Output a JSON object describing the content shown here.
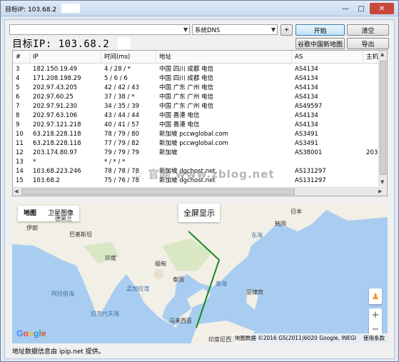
{
  "window": {
    "title": "目标IP: 103.68.2",
    "close_glyph": "✕",
    "min_glyph": "—",
    "max_glyph": "□"
  },
  "toolbar": {
    "target_input_value": "",
    "dns_select_value": "系统DNS",
    "add_label": "+",
    "start_label": "开始",
    "clear_label": "清空",
    "map_label": "谷歌中国新地图",
    "export_label": "导出",
    "target_ip_label": "目标IP: 103.68.2"
  },
  "table": {
    "columns": [
      "#",
      "IP",
      "时间(ms)",
      "地址",
      "AS",
      "主机"
    ],
    "rows": [
      [
        "3",
        "182.150.19.49",
        "4 / 28 / *",
        "中国 四川 成都 电信",
        "AS4134",
        ""
      ],
      [
        "4",
        "171.208.198.29",
        "5 / 6 / 6",
        "中国 四川 成都 电信",
        "AS4134",
        ""
      ],
      [
        "5",
        "202.97.43.205",
        "42 / 42 / 43",
        "中国 广东 广州 电信",
        "AS4134",
        ""
      ],
      [
        "6",
        "202.97.60.25",
        "37 / 38 / *",
        "中国 广东 广州 电信",
        "AS4134",
        ""
      ],
      [
        "7",
        "202.97.91.230",
        "34 / 35 / 39",
        "中国 广东 广州 电信",
        "AS49597",
        ""
      ],
      [
        "8",
        "202.97.63.106",
        "43 / 44 / 44",
        "中国 香港 电信",
        "AS4134",
        ""
      ],
      [
        "9",
        "202.97.121.218",
        "40 / 41 / 57",
        "中国 香港 电信",
        "AS4134",
        ""
      ],
      [
        "10",
        "63.218.228.118",
        "78 / 79 / 80",
        "新加坡 pccwglobal.com",
        "AS3491",
        ""
      ],
      [
        "11",
        "63.218.228.118",
        "77 / 79 / 82",
        "新加坡 pccwglobal.com",
        "AS3491",
        ""
      ],
      [
        "12",
        "203.174.80.97",
        "79 / 79 / 79",
        "新加坡",
        "AS38001",
        "203"
      ],
      [
        "13",
        "*",
        "* / * / *",
        "",
        "",
        ""
      ],
      [
        "14",
        "103.68.223.246",
        "78 / 78 / 78",
        "新加坡 dgchost.net",
        "AS131297",
        ""
      ],
      [
        "15",
        "103.68.2",
        "75 / 76 / 78",
        "新加坡 dgchost.net",
        "AS131297",
        ""
      ]
    ]
  },
  "watermark": "☆ 官网 www.zblog.net",
  "map": {
    "tab_map": "地图",
    "tab_satellite": "卫星图像",
    "fullscreen": "全屏显示",
    "labels": {
      "tehran": "德黑兰",
      "iran": "伊朗",
      "pakistan": "巴基斯坦",
      "india": "印度",
      "myanmar": "缅甸",
      "thailand": "泰国",
      "malaysia": "马来西亚",
      "korea": "韩国",
      "japan": "日本",
      "east_sea": "东海",
      "philippines": "菲律宾",
      "south_sea": "南海",
      "arabian_sea": "阿拉伯海",
      "bengal": "孟加拉湾",
      "laccadive": "拉克代夫海",
      "indonesia": "印度尼西亚"
    },
    "google": "Google",
    "attribution": "地图数据 ©2016 GS(2011)6020 Google, INEGI",
    "terms": "使用条款",
    "zoom_in": "+",
    "zoom_out": "−",
    "pegman_glyph": "♟",
    "colors": {
      "route": "#178a20",
      "land": "#f2efe6",
      "water": "#a8cdf0"
    }
  },
  "footer": "地址数据信息由 ipip.net 提供。"
}
